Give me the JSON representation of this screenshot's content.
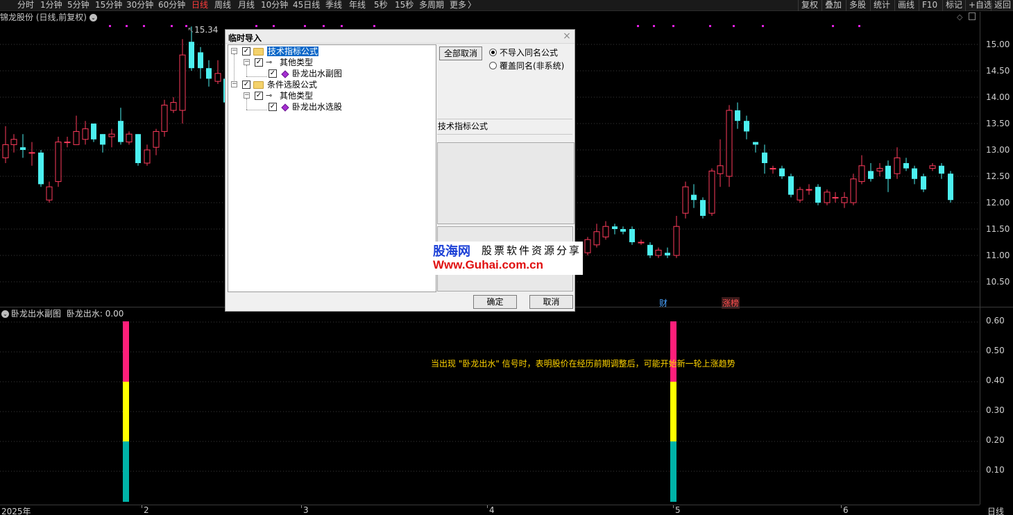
{
  "toolbar": {
    "periods": [
      {
        "label": "分时",
        "active": false
      },
      {
        "label": "1分钟",
        "active": false
      },
      {
        "label": "5分钟",
        "active": false
      },
      {
        "label": "15分钟",
        "active": false
      },
      {
        "label": "30分钟",
        "active": false
      },
      {
        "label": "60分钟",
        "active": false
      },
      {
        "label": "日线",
        "active": true
      },
      {
        "label": "周线",
        "active": false
      },
      {
        "label": "月线",
        "active": false
      },
      {
        "label": "10分钟",
        "active": false
      },
      {
        "label": "45日线",
        "active": false
      },
      {
        "label": "季线",
        "active": false
      },
      {
        "label": "年线",
        "active": false
      },
      {
        "label": "5秒",
        "active": false
      },
      {
        "label": "15秒",
        "active": false
      },
      {
        "label": "多周期",
        "active": false
      },
      {
        "label": "更多",
        "active": false
      }
    ],
    "more_arrow": "〉",
    "right_buttons": [
      "复权",
      "叠加",
      "多股",
      "统计",
      "画线",
      "F10",
      "标记",
      "+自选",
      "返回"
    ]
  },
  "chart_header": {
    "title": "锦龙股份 (日线,前复权)",
    "peak_label": "15.34"
  },
  "price_axis": [
    "15.00",
    "14.50",
    "14.00",
    "13.50",
    "13.00",
    "12.50",
    "12.00",
    "11.50",
    "11.00",
    "10.50"
  ],
  "event_tags": {
    "finance": "财",
    "limit_up": "涨榜"
  },
  "dialog": {
    "title": "临时导入",
    "close_glyph": "×",
    "tree": {
      "root1": "技术指标公式",
      "child1": "其他类型",
      "leaf1": "卧龙出水副图",
      "root2": "条件选股公式",
      "child2": "其他类型",
      "leaf2": "卧龙出水选股"
    },
    "cancel_all": "全部取消",
    "radio_no_import": "不导入同名公式",
    "radio_overwrite": "覆盖同名(非系统)",
    "info_label": "技术指标公式",
    "ok": "确定",
    "cancel": "取消"
  },
  "watermark": {
    "brand": "股海网",
    "slogan": "股票软件资源分享",
    "url": "Www.Guhai.com.cn"
  },
  "indicator": {
    "title": "卧龙出水副图",
    "readout": "卧龙出水: 0.00",
    "notice": "当出现 \"卧龙出水\" 信号时，表明股价在经历前期调整后，可能开始新一轮上涨趋势",
    "axis": [
      "0.60",
      "0.50",
      "0.40",
      "0.30",
      "0.20",
      "0.10"
    ]
  },
  "time_axis": {
    "labels": [
      "2025年",
      "2",
      "3",
      "4",
      "5",
      "6"
    ],
    "period": "日线"
  },
  "colors": {
    "up": "#ff3b5c",
    "down": "#4cf0f0",
    "bar_top": "#ff1f7a",
    "bar_mid": "#ffff00",
    "bar_low": "#00b3a8",
    "marker": "#e020e0"
  }
}
